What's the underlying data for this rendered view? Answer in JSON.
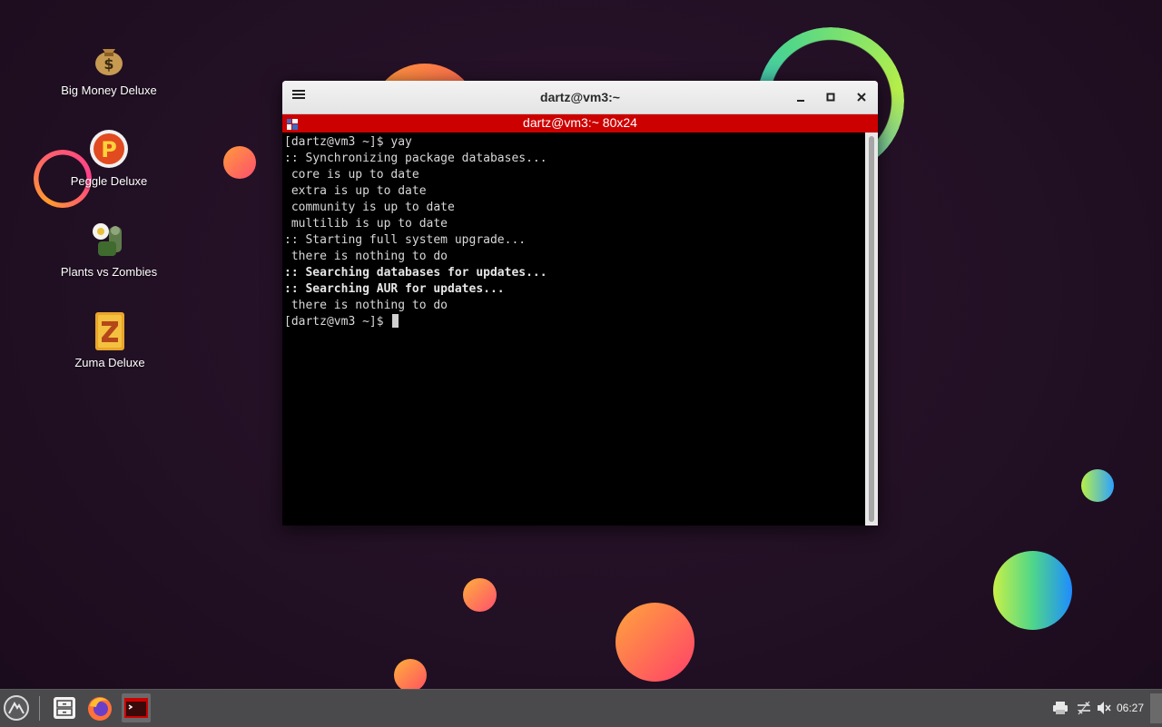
{
  "desktop": {
    "icons": [
      {
        "label": "Big Money Deluxe",
        "icon": "money-bag-icon"
      },
      {
        "label": "Peggle Deluxe",
        "icon": "peggle-icon"
      },
      {
        "label": "Plants vs Zombies",
        "icon": "plants-vs-zombies-icon"
      },
      {
        "label": "Zuma Deluxe",
        "icon": "zuma-icon"
      }
    ]
  },
  "window": {
    "title": "dartz@vm3:~",
    "tab_title": "dartz@vm3:~ 80x24",
    "buttons": {
      "menu": "menu-icon",
      "minimize": "minimize-icon",
      "maximize": "maximize-icon",
      "close": "close-icon"
    }
  },
  "terminal": {
    "lines": [
      "[dartz@vm3 ~]$ yay",
      ":: Synchronizing package databases...",
      " core is up to date",
      " extra is up to date",
      " community is up to date",
      " multilib is up to date",
      ":: Starting full system upgrade...",
      " there is nothing to do",
      ":: Searching databases for updates...",
      ":: Searching AUR for updates...",
      " there is nothing to do"
    ],
    "prompt": "[dartz@vm3 ~]$"
  },
  "taskbar": {
    "apps": [
      "menu-launcher-icon",
      "file-manager-icon",
      "firefox-icon",
      "terminal-icon"
    ],
    "tray": [
      "printer-icon",
      "network-icon",
      "volume-muted-icon"
    ],
    "clock": "06:27"
  },
  "colors": {
    "tab_bar": "#cd0000",
    "terminal_bg": "#000000",
    "taskbar_bg": "#4a4a4c"
  }
}
